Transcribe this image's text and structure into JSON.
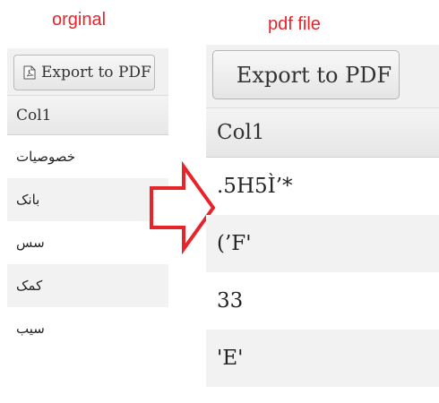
{
  "captions": {
    "original": "orginal",
    "pdf": "pdf file"
  },
  "original_panel": {
    "export_button": "Export to PDF",
    "column_header": "Col1",
    "rows": [
      "خصوصيات",
      "بانک",
      "سس",
      "کمک",
      "سیب"
    ]
  },
  "pdf_panel": {
    "export_button": "Export to PDF",
    "column_header": "Col1",
    "rows": [
      ".5H5Ì’*",
      "(’F'",
      "33",
      "'E'"
    ]
  },
  "colors": {
    "caption": "#e8232a",
    "arrow": "#e8232a",
    "stripe": "#f2f2f2"
  },
  "icons": {
    "export_button": "pdf-file-icon",
    "between_panels": "arrow-right-icon"
  }
}
